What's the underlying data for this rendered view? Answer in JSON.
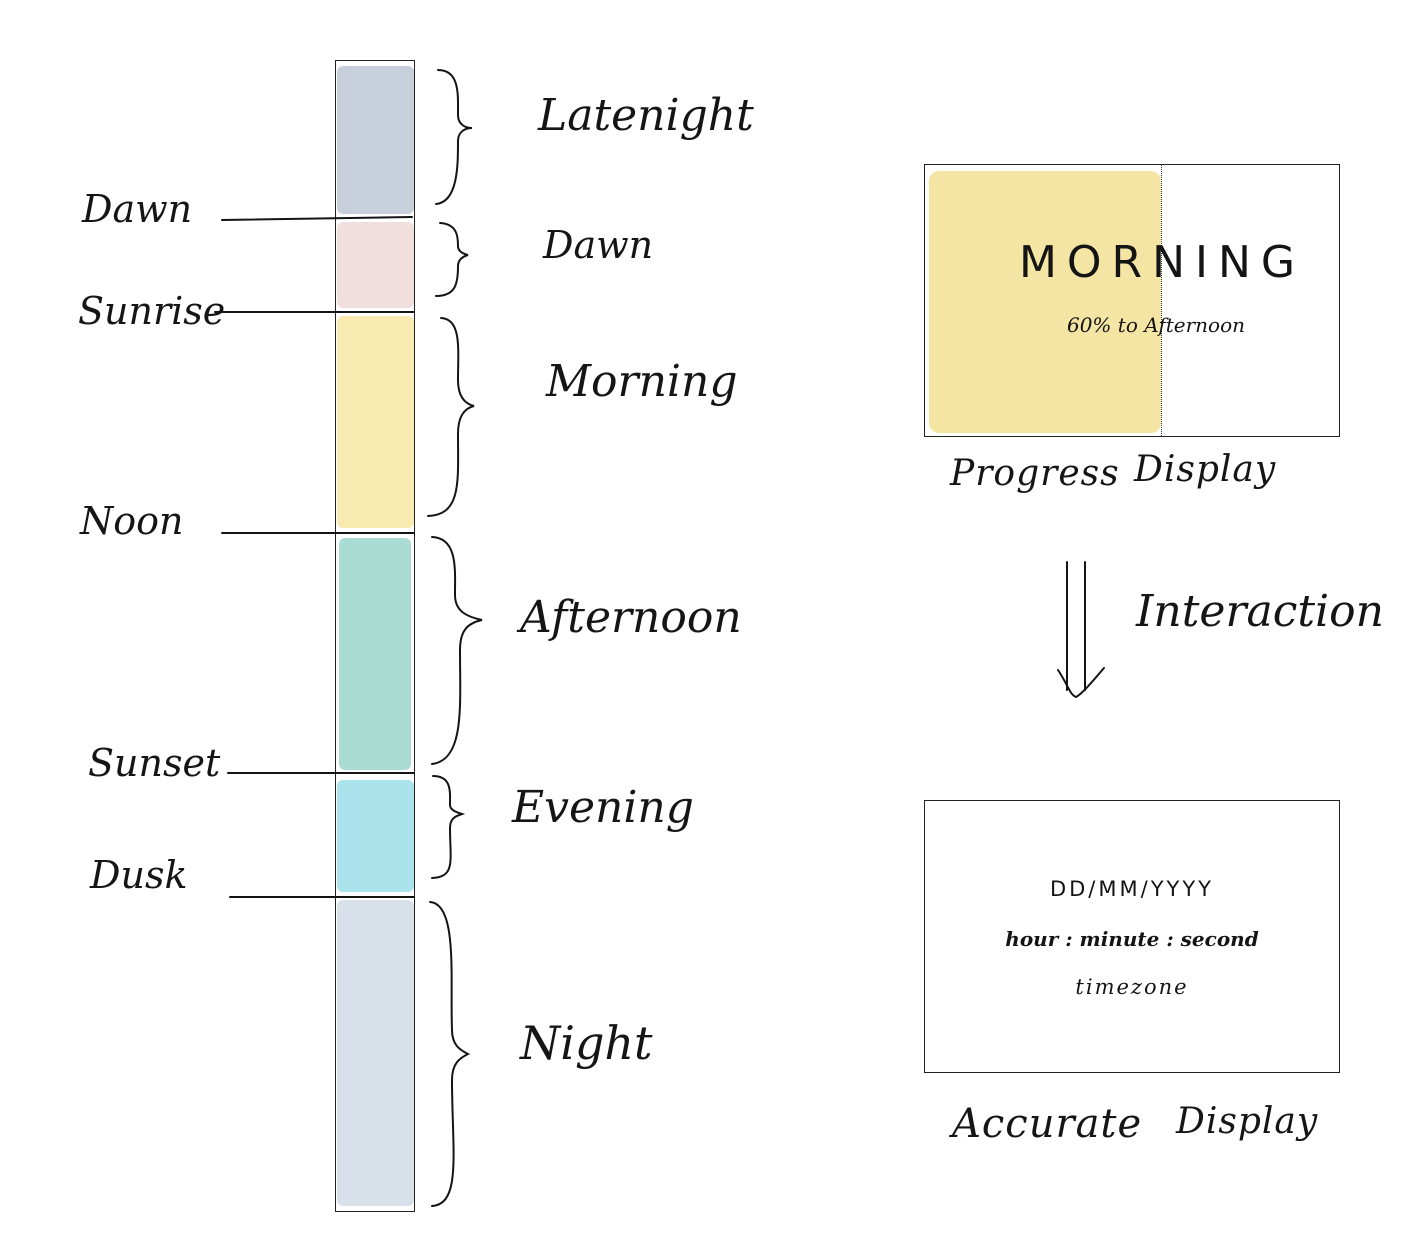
{
  "colors": {
    "late_night": "#c7d0da",
    "dawn": "#f1dfde",
    "morning": "#f8eab1",
    "afternoon": "#abdcd3",
    "evening": "#abe3ec",
    "night": "#d8e0ea",
    "progress_fill": "#f5e5a4",
    "ink": "#141414"
  },
  "timeline": {
    "periods": [
      {
        "id": "late-night",
        "label": "Latenight"
      },
      {
        "id": "dawn",
        "label": "Dawn"
      },
      {
        "id": "morning",
        "label": "Morning"
      },
      {
        "id": "afternoon",
        "label": "Afternoon"
      },
      {
        "id": "evening",
        "label": "Evening"
      },
      {
        "id": "night",
        "label": "Night"
      }
    ],
    "boundaries": [
      "Dawn",
      "Sunrise",
      "Noon",
      "Sunset",
      "Dusk"
    ]
  },
  "progress_display": {
    "period_title": "MORNING",
    "progress_text": "60% to Afternoon",
    "progress_fraction": 0.57,
    "caption_left": "Progress",
    "caption_right": "Display"
  },
  "interaction_label": "Interaction",
  "accurate_display": {
    "date_format": "DD/MM/YYYY",
    "time_format": "hour : minute : second",
    "timezone_label": "timezone",
    "caption_left": "Accurate",
    "caption_right": "Display"
  }
}
